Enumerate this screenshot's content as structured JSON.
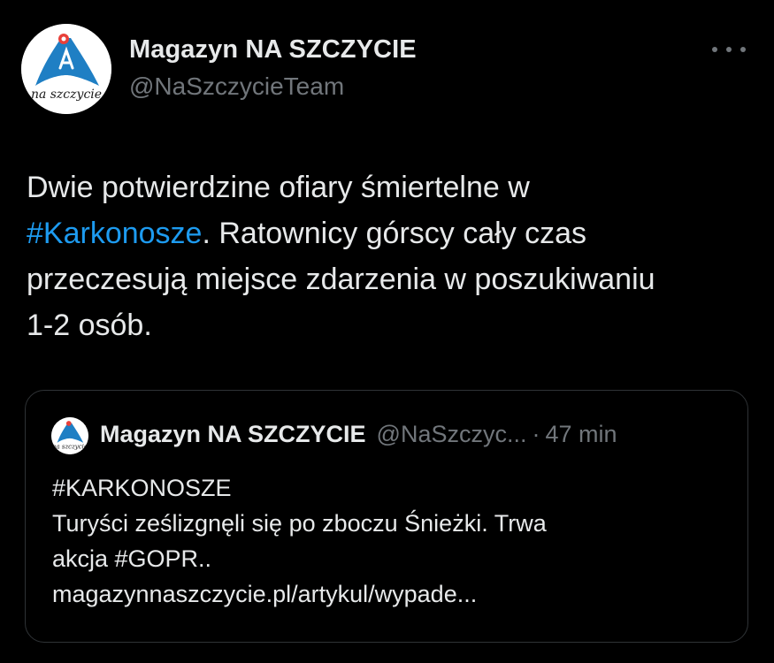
{
  "author": {
    "name": "Magazyn NA SZCZYCIE",
    "handle": "@NaSzczycieTeam",
    "avatar_text": "na szczycie"
  },
  "more_icon": "more-horizontal-icon",
  "tweet": {
    "lines": [
      {
        "text": "Dwie potwierdzine ofiary śmiertelne w"
      },
      {
        "hashtag": "#Karkonosze",
        "text": ". Ratownicy górscy cały czas"
      },
      {
        "text": "przeczesują miejsce zdarzenia w poszukiwaniu"
      },
      {
        "text": "1-2 osób."
      }
    ]
  },
  "quote": {
    "name": "Magazyn NA SZCZYCIE",
    "handle": "@NaSzczyc...",
    "separator": "·",
    "time": "47 min",
    "avatar_text": "na szczycie",
    "lines": [
      "#KARKONOSZE",
      "Turyści ześlizgnęli się po zboczu Śnieżki. Trwa",
      "akcja #GOPR..",
      "magazynnaszczycie.pl/artykul/wypade..."
    ]
  },
  "colors": {
    "background": "#000000",
    "text": "#e7e9ea",
    "secondary": "#71767b",
    "link": "#1d9bf0",
    "border": "#2f3336",
    "logo_blue": "#1f7fc4",
    "logo_red": "#e8403a"
  }
}
